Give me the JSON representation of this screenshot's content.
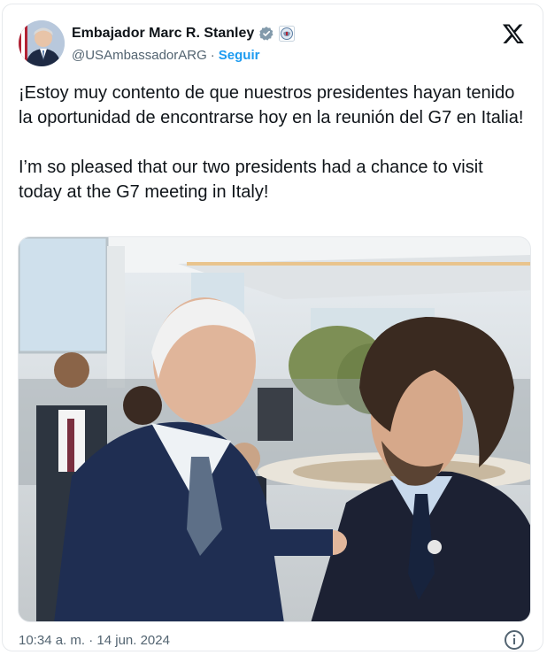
{
  "author": {
    "display_name": "Embajador Marc R. Stanley",
    "handle": "@USAmbassadorARG",
    "separator": "·",
    "follow_label": "Seguir",
    "verified_icon": "verified-badge-icon",
    "affiliation_icon": "us-seal-icon"
  },
  "tweet": {
    "text_es": "¡Estoy muy contento de que nuestros presidentes hayan tenido la oportunidad de encontrarse hoy en la reunión del G7 en Italia!",
    "text_en": "I’m so pleased that our two presidents had a chance to visit today at the G7 meeting in Italy!"
  },
  "media": {
    "alt": ""
  },
  "footer": {
    "time": "10:34 a. m.",
    "separator": "·",
    "date": "14 jun. 2024"
  },
  "colors": {
    "accent": "#1d9bf0",
    "text": "#0f1419",
    "muted": "#536471"
  }
}
